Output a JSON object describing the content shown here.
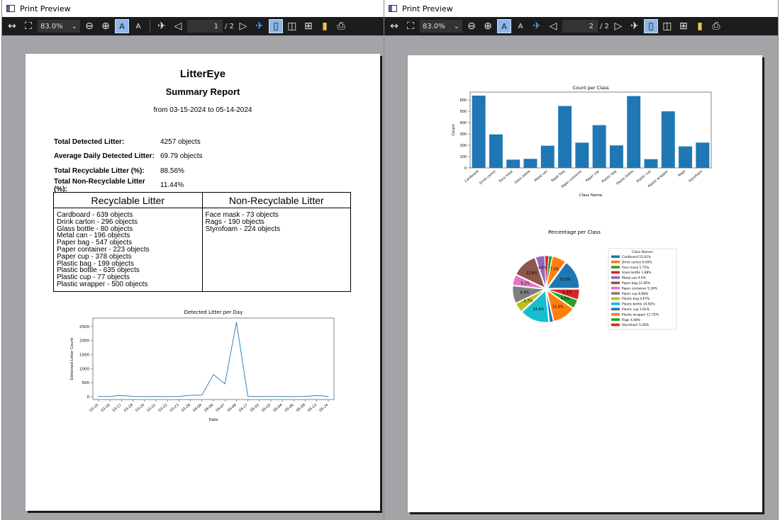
{
  "windows": [
    {
      "title": "Print Preview",
      "toolbar": {
        "zoom": "83.0%",
        "page": "1",
        "total": "/ 2"
      }
    },
    {
      "title": "Print Preview",
      "toolbar": {
        "zoom": "83.0%",
        "page": "2",
        "total": "/ 2"
      }
    }
  ],
  "report": {
    "title": "LitterEye",
    "subtitle": "Summary Report",
    "range": "from 03-15-2024 to 05-14-2024",
    "stats": [
      {
        "label": "Total Detected Litter:",
        "value": "4257 objects"
      },
      {
        "label": "Average Daily Detected Litter:",
        "value": "69.79 objects"
      },
      {
        "label": "Total Recyclable Litter (%):",
        "value": "88.56%"
      },
      {
        "label": "Total Non-Recyclable Litter (%):",
        "value": "11.44%"
      }
    ],
    "recyclable_header": "Recyclable Litter",
    "nonrecyclable_header": "Non-Recyclable Litter",
    "recyclable_items": [
      "Cardboard - 639 objects",
      "Drink carton - 296 objects",
      "Glass bottle - 80 objects",
      "Metal can - 196 objects",
      "Paper bag - 547 objects",
      "Paper container - 223 objects",
      "Paper cup - 378 objects",
      "Plastic bag - 199 objects",
      "Plastic bottle - 635 objects",
      "Plastic cup - 77 objects",
      "Plastic wrapper - 500 objects"
    ],
    "nonrecyclable_items": [
      "Face mask - 73 objects",
      "Rags - 190 objects",
      "Styrofoam - 224 objects"
    ]
  },
  "chart_data": [
    {
      "type": "line",
      "title": "Detected Litter per Day",
      "xlabel": "Date",
      "ylabel": "Detected Litter Count",
      "xtick_labels": [
        "03-15",
        "03-16",
        "03-17",
        "03-19",
        "03-20",
        "03-21",
        "03-22",
        "03-23",
        "03-28",
        "04-04",
        "04-06",
        "04-07",
        "04-08",
        "04-17",
        "05-02",
        "05-03",
        "05-04",
        "05-06",
        "05-09",
        "05-13",
        "05-14"
      ],
      "yticks": [
        0,
        500,
        1000,
        1500,
        2000,
        2500
      ],
      "ylim": [
        -100,
        2800
      ],
      "x": [
        "03-15",
        "03-16",
        "03-17",
        "03-19",
        "03-20",
        "03-21",
        "03-22",
        "03-23",
        "03-28",
        "04-04",
        "04-06",
        "04-07",
        "04-08",
        "04-17",
        "05-02",
        "05-03",
        "05-04",
        "05-06",
        "05-09",
        "05-13",
        "05-14"
      ],
      "values": [
        10,
        15,
        45,
        10,
        5,
        8,
        5,
        10,
        50,
        60,
        790,
        460,
        2650,
        15,
        5,
        10,
        8,
        5,
        10,
        45,
        10
      ],
      "color": "#1f77b4"
    },
    {
      "type": "bar",
      "title": "Count per Class",
      "xlabel": "Class Name",
      "ylabel": "Count",
      "yticks": [
        0,
        100,
        200,
        300,
        400,
        500,
        600
      ],
      "ylim": [
        0,
        670
      ],
      "categories": [
        "Cardboard",
        "Drink carton",
        "Face mask",
        "Glass bottle",
        "Metal can",
        "Paper bag",
        "Paper container",
        "Paper cup",
        "Plastic bag",
        "Plastic bottle",
        "Plastic cup",
        "Plastic wrapper",
        "Rags",
        "Styrofoam"
      ],
      "values": [
        639,
        296,
        73,
        80,
        196,
        547,
        223,
        378,
        199,
        635,
        77,
        500,
        190,
        224
      ],
      "color": "#1f77b4"
    },
    {
      "type": "pie",
      "title": "Percentage per Class",
      "legend_title": "Class Names",
      "legend": "right",
      "slices": [
        {
          "label": "Cardboard",
          "legend": "Cardboard 15.01%",
          "value": 15.0,
          "text": "15.0%",
          "color": "#1f77b4"
        },
        {
          "label": "Drink carton",
          "legend": "Drink carton 6.95%",
          "value": 6.95,
          "text": "7.0%",
          "color": "#ff7f0e"
        },
        {
          "label": "Face mask",
          "legend": "Face mask 1.71%",
          "value": 1.71,
          "text": "",
          "color": "#2ca02c"
        },
        {
          "label": "Glass bottle",
          "legend": "Glass bottle 1.88%",
          "value": 1.88,
          "text": "",
          "color": "#d62728"
        },
        {
          "label": "Metal can",
          "legend": "Metal can 4.6%",
          "value": 4.6,
          "text": "4.6%",
          "color": "#9467bd"
        },
        {
          "label": "Paper bag",
          "legend": "Paper bag 12.85%",
          "value": 12.85,
          "text": "12.8%",
          "color": "#8c564b"
        },
        {
          "label": "Paper container",
          "legend": "Paper container 5.24%",
          "value": 5.24,
          "text": "5.2%",
          "color": "#e377c2"
        },
        {
          "label": "Paper cup",
          "legend": "Paper cup 8.88%",
          "value": 8.88,
          "text": "8.9%",
          "color": "#7f7f7f"
        },
        {
          "label": "Plastic bag",
          "legend": "Plastic bag 4.67%",
          "value": 4.67,
          "text": "4.7%",
          "color": "#bcbd22"
        },
        {
          "label": "Plastic bottle",
          "legend": "Plastic bottle 14.92%",
          "value": 14.92,
          "text": "14.9%",
          "color": "#17becf"
        },
        {
          "label": "Plastic cup",
          "legend": "Plastic cup 1.81%",
          "value": 1.81,
          "text": "",
          "color": "#1f77b4"
        },
        {
          "label": "Plastic wrapper",
          "legend": "Plastic wrapper 11.75%",
          "value": 11.75,
          "text": "11.8%",
          "color": "#ff7f0e"
        },
        {
          "label": "Rags",
          "legend": "Rags 4.46%",
          "value": 4.46,
          "text": "4.5%",
          "color": "#2ca02c"
        },
        {
          "label": "Styrofoam",
          "legend": "Styrofoam 5.26%",
          "value": 5.26,
          "text": "5.3%",
          "color": "#d62728"
        }
      ]
    }
  ]
}
